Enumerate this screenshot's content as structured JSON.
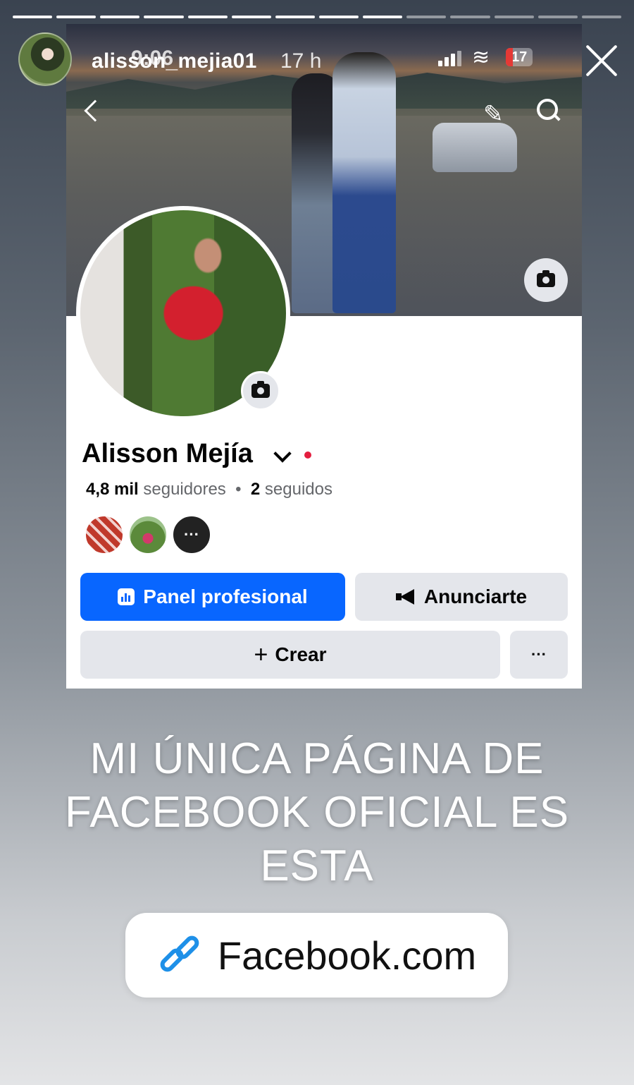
{
  "story": {
    "username": "alisson_mejia01",
    "time_ago": "17 h",
    "progress_total": 14,
    "progress_done": 9
  },
  "status_bar": {
    "time": "9:06",
    "battery": "17"
  },
  "profile": {
    "name": "Alisson Mejía",
    "followers_count": "4,8 mil",
    "followers_label": "seguidores",
    "following_count": "2",
    "following_label": "seguidos",
    "more_friends": "···"
  },
  "buttons": {
    "panel": "Panel profesional",
    "ads": "Anunciarte",
    "create": "Crear",
    "more": "···"
  },
  "caption": "MI ÚNICA PÁGINA DE FACEBOOK OFICIAL ES ESTA",
  "link_sticker": {
    "label": "Facebook.com"
  },
  "colors": {
    "primary_button": "#0866ff",
    "secondary_button": "#e4e6eb",
    "link_icon": "#1e90e8",
    "notification_dot": "#e41e3f"
  }
}
